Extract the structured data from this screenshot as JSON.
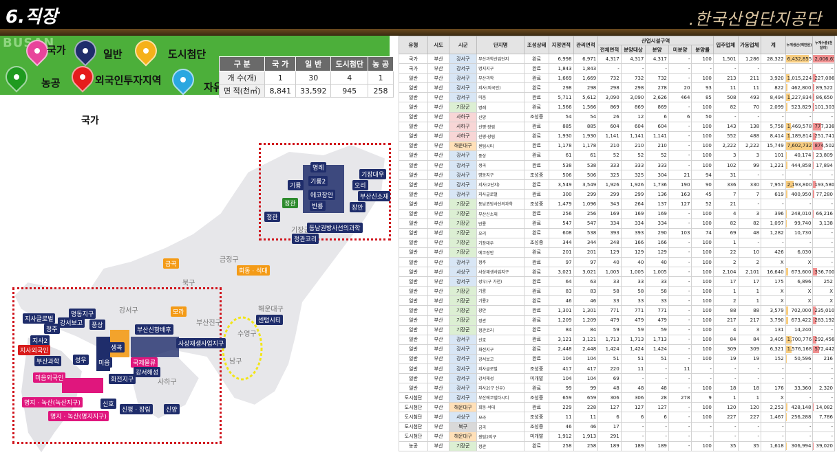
{
  "header": {
    "title": "6.직장",
    "org": ".한국산업단지공단"
  },
  "legend": {
    "busan_mark": "BUSAN",
    "items": [
      {
        "label": "국가",
        "color": "#e8449b",
        "icon": "pink-map-pin"
      },
      {
        "label": "일반",
        "color": "#1f2d6b",
        "icon": "navy-map-pin"
      },
      {
        "label": "도시첨단",
        "color": "#f5b11a",
        "icon": "yellow-map-pin"
      },
      {
        "label": "농공",
        "color": "#1f9a1f",
        "icon": "green-map-pin"
      },
      {
        "label": "외국인투자지역",
        "color": "#e51c1c",
        "icon": "red-map-pin"
      },
      {
        "label": "자유무역지역",
        "color": "#2aa7e0",
        "icon": "blue-map-pin"
      }
    ],
    "table": {
      "headers": [
        "구 분",
        "국 가",
        "일 반",
        "도시첨단",
        "농 공"
      ],
      "rows": [
        [
          "개 수(개)",
          "1",
          "30",
          "4",
          "1"
        ],
        [
          "면 적(천㎡)",
          "8,841",
          "33,592",
          "945",
          "258"
        ]
      ]
    }
  },
  "map": {
    "top_label": "국가",
    "labels": [
      {
        "t": "명례",
        "c": ""
      },
      {
        "t": "기룡2",
        "c": ""
      },
      {
        "t": "기장대우",
        "c": ""
      },
      {
        "t": "오리",
        "c": ""
      },
      {
        "t": "기룡",
        "c": ""
      },
      {
        "t": "에코장안",
        "c": ""
      },
      {
        "t": "부산신소재",
        "c": ""
      },
      {
        "t": "정관",
        "c": "green"
      },
      {
        "t": "반룡",
        "c": ""
      },
      {
        "t": "장안",
        "c": ""
      },
      {
        "t": "정관",
        "c": ""
      },
      {
        "t": "기장군",
        "c": "gray"
      },
      {
        "t": "동남권방사선의과학",
        "c": ""
      },
      {
        "t": "정관코리",
        "c": ""
      },
      {
        "t": "금곡",
        "c": "orange"
      },
      {
        "t": "금정구",
        "c": "gray"
      },
      {
        "t": "회동 · 석대",
        "c": "orange"
      },
      {
        "t": "북구",
        "c": "gray"
      },
      {
        "t": "해운대구",
        "c": "gray"
      },
      {
        "t": "모라",
        "c": "orange"
      },
      {
        "t": "센텀시티",
        "c": ""
      },
      {
        "t": "지사글로벌",
        "c": ""
      },
      {
        "t": "명동지구",
        "c": ""
      },
      {
        "t": "정주",
        "c": ""
      },
      {
        "t": "강서보고",
        "c": ""
      },
      {
        "t": "풍상",
        "c": ""
      },
      {
        "t": "강서구",
        "c": "gray"
      },
      {
        "t": "부산신항배후",
        "c": ""
      },
      {
        "t": "부산진구",
        "c": "gray"
      },
      {
        "t": "수영구",
        "c": "gray"
      },
      {
        "t": "지사2",
        "c": ""
      },
      {
        "t": "사상재생사업지구",
        "c": ""
      },
      {
        "t": "지사외국인",
        "c": "red"
      },
      {
        "t": "생곡",
        "c": ""
      },
      {
        "t": "부산과학",
        "c": ""
      },
      {
        "t": "성우",
        "c": ""
      },
      {
        "t": "미음",
        "c": ""
      },
      {
        "t": "국제물류",
        "c": "pink"
      },
      {
        "t": "미음외국인",
        "c": "pink"
      },
      {
        "t": "화전지구",
        "c": ""
      },
      {
        "t": "강서해성",
        "c": ""
      },
      {
        "t": "사하구",
        "c": "gray"
      },
      {
        "t": "남구",
        "c": "gray"
      },
      {
        "t": "명지 · 녹산(녹산지구)",
        "c": "pink"
      },
      {
        "t": "신호",
        "c": ""
      },
      {
        "t": "신평 · 장림",
        "c": ""
      },
      {
        "t": "신양",
        "c": ""
      },
      {
        "t": "명지 · 녹산(명지지구)",
        "c": "pink"
      }
    ]
  },
  "table": {
    "group_header": "산업시설구역",
    "headers": [
      "유형",
      "시도",
      "시군",
      "단지명",
      "조성상태",
      "지정면적",
      "관리면적",
      "전체면적",
      "분양대상",
      "분양",
      "미분양",
      "분양률",
      "입주업체",
      "가동업체",
      "계",
      "누계생산(백만원)",
      "누계수출(천달러)"
    ],
    "rows": [
      [
        "국가",
        "부산",
        "강서구",
        "부산과학산업단지",
        "완료",
        "6,998",
        "6,971",
        "4,317",
        "4,317",
        "4,317",
        "-",
        "100",
        "1,501",
        "1,286",
        "28,322",
        "6,432,855",
        "2,006,631"
      ],
      [
        "국가",
        "부산",
        "강서구",
        "명지지구",
        "완료",
        "1,843",
        "1,843",
        "-",
        "-",
        "-",
        "-",
        "-",
        "-",
        "-",
        "-",
        "-",
        "-"
      ],
      [
        "일반",
        "부산",
        "강서구",
        "부산과학",
        "완료",
        "1,669",
        "1,669",
        "732",
        "732",
        "732",
        "-",
        "100",
        "213",
        "211",
        "3,920",
        "1,015,224",
        "227,086"
      ],
      [
        "일반",
        "부산",
        "강서구",
        "지사(외국인)",
        "완료",
        "298",
        "298",
        "298",
        "298",
        "278",
        "20",
        "93",
        "11",
        "11",
        "822",
        "462,800",
        "89,522"
      ],
      [
        "일반",
        "부산",
        "강서구",
        "미음",
        "완료",
        "5,711",
        "5,612",
        "3,090",
        "3,090",
        "2,626",
        "464",
        "85",
        "508",
        "493",
        "8,494",
        "1,227,834",
        "86,650"
      ],
      [
        "일반",
        "부산",
        "기장군",
        "명례",
        "완료",
        "1,566",
        "1,566",
        "869",
        "869",
        "869",
        "-",
        "100",
        "82",
        "70",
        "2,099",
        "523,829",
        "101,303"
      ],
      [
        "일반",
        "부산",
        "사하구",
        "신양",
        "조성중",
        "54",
        "54",
        "26",
        "12",
        "6",
        "6",
        "50",
        "-",
        "-",
        "-",
        "-",
        "-"
      ],
      [
        "일반",
        "부산",
        "사하구",
        "신평·장림",
        "완료",
        "885",
        "885",
        "604",
        "604",
        "604",
        "-",
        "100",
        "143",
        "138",
        "5,758",
        "1,469,578",
        "777,338"
      ],
      [
        "일반",
        "부산",
        "사하구",
        "신평·장림",
        "완료",
        "1,930",
        "1,930",
        "1,141",
        "1,141",
        "1,141",
        "-",
        "100",
        "552",
        "488",
        "8,414",
        "1,189,814",
        "251,741"
      ],
      [
        "일반",
        "부산",
        "해운대구",
        "센텀시티",
        "완료",
        "1,178",
        "1,178",
        "210",
        "210",
        "210",
        "-",
        "100",
        "2,222",
        "2,222",
        "15,749",
        "7,602,732",
        "874,502"
      ],
      [
        "일반",
        "부산",
        "강서구",
        "풍상",
        "완료",
        "61",
        "61",
        "52",
        "52",
        "52",
        "-",
        "100",
        "3",
        "3",
        "101",
        "40,174",
        "23,809"
      ],
      [
        "일반",
        "부산",
        "강서구",
        "생곡",
        "완료",
        "538",
        "538",
        "333",
        "333",
        "333",
        "-",
        "100",
        "102",
        "99",
        "1,221",
        "444,858",
        "17,894"
      ],
      [
        "일반",
        "부산",
        "강서구",
        "명동지구",
        "조성중",
        "506",
        "506",
        "325",
        "325",
        "304",
        "21",
        "94",
        "31",
        "-",
        "-",
        "-",
        "-"
      ],
      [
        "일반",
        "부산",
        "강서구",
        "지사(2단지)",
        "완료",
        "3,549",
        "3,549",
        "1,926",
        "1,926",
        "1,736",
        "190",
        "90",
        "336",
        "330",
        "7,957",
        "2,193,800",
        "193,580"
      ],
      [
        "일반",
        "부산",
        "강서구",
        "지사글로벌",
        "완료",
        "300",
        "299",
        "299",
        "299",
        "136",
        "163",
        "45",
        "7",
        "7",
        "619",
        "400,950",
        "77,280"
      ],
      [
        "일반",
        "부산",
        "기장군",
        "동남권방사선의과학",
        "조성중",
        "1,479",
        "1,096",
        "343",
        "264",
        "137",
        "127",
        "52",
        "21",
        "-",
        "-",
        "-",
        "-"
      ],
      [
        "일반",
        "부산",
        "기장군",
        "부산신소재",
        "완료",
        "256",
        "256",
        "169",
        "169",
        "169",
        "-",
        "100",
        "4",
        "3",
        "396",
        "248,010",
        "66,216"
      ],
      [
        "일반",
        "부산",
        "기장군",
        "반룡",
        "완료",
        "547",
        "547",
        "334",
        "334",
        "334",
        "-",
        "100",
        "82",
        "82",
        "1,097",
        "99,740",
        "3,138"
      ],
      [
        "일반",
        "부산",
        "기장군",
        "오리",
        "완료",
        "608",
        "538",
        "393",
        "393",
        "290",
        "103",
        "74",
        "69",
        "48",
        "1,282",
        "10,730",
        "-"
      ],
      [
        "일반",
        "부산",
        "기장군",
        "기장대우",
        "조성중",
        "344",
        "344",
        "248",
        "166",
        "166",
        "-",
        "100",
        "1",
        "-",
        "-",
        "-",
        "-"
      ],
      [
        "일반",
        "부산",
        "기장군",
        "에코장안",
        "완료",
        "201",
        "201",
        "129",
        "129",
        "129",
        "-",
        "100",
        "22",
        "10",
        "426",
        "6,030",
        "-"
      ],
      [
        "일반",
        "부산",
        "강서구",
        "정주",
        "완료",
        "97",
        "97",
        "40",
        "40",
        "40",
        "-",
        "100",
        "2",
        "2",
        "X",
        "X",
        "-"
      ],
      [
        "일반",
        "부산",
        "사상구",
        "사상재생사업지구",
        "완료",
        "3,021",
        "3,021",
        "1,005",
        "1,005",
        "1,005",
        "-",
        "100",
        "2,104",
        "2,101",
        "16,640",
        "673,600",
        "336,700"
      ],
      [
        "일반",
        "부산",
        "강서구",
        "성우(구 가천)",
        "완료",
        "64",
        "63",
        "33",
        "33",
        "33",
        "-",
        "100",
        "17",
        "17",
        "175",
        "6,896",
        "252"
      ],
      [
        "일반",
        "부산",
        "기장군",
        "기룡",
        "완료",
        "83",
        "83",
        "58",
        "58",
        "58",
        "-",
        "100",
        "1",
        "1",
        "X",
        "X",
        "X"
      ],
      [
        "일반",
        "부산",
        "기장군",
        "기룡2",
        "완료",
        "46",
        "46",
        "33",
        "33",
        "33",
        "-",
        "100",
        "2",
        "1",
        "X",
        "X",
        "X"
      ],
      [
        "일반",
        "부산",
        "기장군",
        "장안",
        "완료",
        "1,301",
        "1,301",
        "771",
        "771",
        "771",
        "-",
        "100",
        "88",
        "88",
        "3,579",
        "702,000",
        "235,010"
      ],
      [
        "일반",
        "부산",
        "기장군",
        "정관",
        "완료",
        "1,209",
        "1,209",
        "479",
        "479",
        "479",
        "-",
        "100",
        "217",
        "217",
        "3,790",
        "673,422",
        "283,192"
      ],
      [
        "일반",
        "부산",
        "기장군",
        "정관코리",
        "완료",
        "84",
        "84",
        "59",
        "59",
        "59",
        "-",
        "100",
        "4",
        "3",
        "131",
        "14,240",
        "-"
      ],
      [
        "일반",
        "부산",
        "강서구",
        "신호",
        "완료",
        "3,121",
        "3,121",
        "1,713",
        "1,713",
        "1,713",
        "-",
        "100",
        "84",
        "84",
        "3,405",
        "1,700,776",
        "292,456"
      ],
      [
        "일반",
        "부산",
        "강서구",
        "화전지구",
        "완료",
        "2,448",
        "2,448",
        "1,424",
        "1,424",
        "1,424",
        "-",
        "100",
        "309",
        "309",
        "6,321",
        "1,576,168",
        "572,442"
      ],
      [
        "일반",
        "부산",
        "강서구",
        "강서보고",
        "완료",
        "104",
        "104",
        "51",
        "51",
        "51",
        "-",
        "100",
        "19",
        "19",
        "152",
        "50,596",
        "216"
      ],
      [
        "일반",
        "부산",
        "강서구",
        "지사글로벌",
        "조성중",
        "417",
        "417",
        "220",
        "11",
        "-",
        "11",
        "-",
        "-",
        "-",
        "-",
        "-",
        "-"
      ],
      [
        "일반",
        "부산",
        "강서구",
        "강서해성",
        "미개발",
        "104",
        "104",
        "69",
        "-",
        "-",
        "-",
        "-",
        "-",
        "-",
        "-",
        "-",
        "-"
      ],
      [
        "일반",
        "부산",
        "강서구",
        "지사2(구 신우)",
        "완료",
        "99",
        "99",
        "48",
        "48",
        "48",
        "-",
        "100",
        "18",
        "18",
        "176",
        "33,360",
        "2,320"
      ],
      [
        "도시첨단",
        "부산",
        "강서구",
        "부산에코델타시티",
        "조성중",
        "659",
        "659",
        "306",
        "306",
        "28",
        "278",
        "9",
        "1",
        "1",
        "X",
        "-",
        "-"
      ],
      [
        "도시첨단",
        "부산",
        "해운대구",
        "회동·석대",
        "완료",
        "229",
        "228",
        "127",
        "127",
        "127",
        "-",
        "100",
        "120",
        "120",
        "2,253",
        "428,148",
        "14,082"
      ],
      [
        "도시첨단",
        "부산",
        "사상구",
        "모라",
        "조성중",
        "11",
        "11",
        "6",
        "6",
        "6",
        "-",
        "100",
        "227",
        "227",
        "1,467",
        "256,288",
        "7,786"
      ],
      [
        "도시첨단",
        "부산",
        "북구",
        "금곡",
        "조성중",
        "46",
        "46",
        "17",
        "-",
        "-",
        "-",
        "-",
        "-",
        "-",
        "-",
        "-",
        "-"
      ],
      [
        "도시첨단",
        "부산",
        "해운대구",
        "센텀2지구",
        "미개발",
        "1,912",
        "1,913",
        "291",
        "-",
        "-",
        "-",
        "-",
        "-",
        "-",
        "-",
        "-",
        "-"
      ],
      [
        "농공",
        "부산",
        "기장군",
        "정관",
        "완료",
        "258",
        "258",
        "189",
        "189",
        "189",
        "-",
        "100",
        "35",
        "35",
        "1,618",
        "306,994",
        "39,020"
      ]
    ]
  }
}
